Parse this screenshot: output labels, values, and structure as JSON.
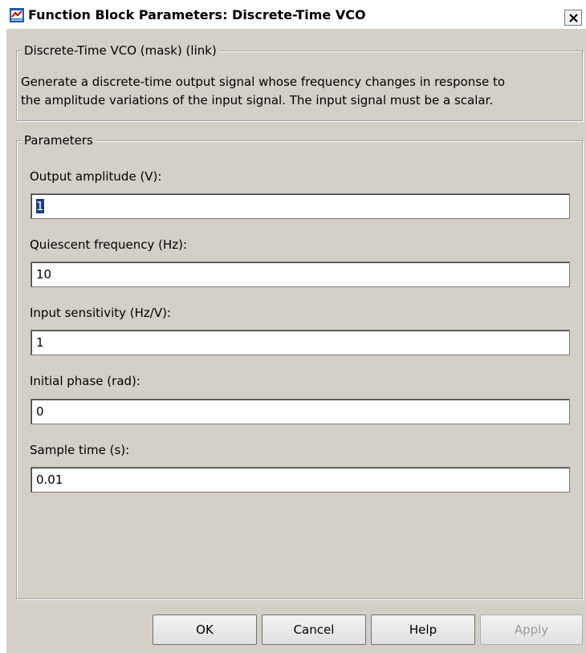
{
  "window": {
    "title": "Function Block Parameters: Discrete-Time VCO",
    "close_label": "X"
  },
  "mask": {
    "legend": "Discrete-Time VCO (mask) (link)",
    "description_line1": "Generate a discrete-time output signal whose frequency changes in response to",
    "description_line2": "the amplitude variations of the input signal. The input signal must be a scalar."
  },
  "parameters": {
    "legend": "Parameters",
    "items": [
      {
        "label": "Output amplitude (V):",
        "value": "1"
      },
      {
        "label": "Quiescent frequency (Hz):",
        "value": "10"
      },
      {
        "label": "Input sensitivity (Hz/V):",
        "value": "1"
      },
      {
        "label": "Initial phase (rad):",
        "value": "0"
      },
      {
        "label": "Sample time (s):",
        "value": "0.01"
      }
    ]
  },
  "buttons": {
    "ok": "OK",
    "cancel": "Cancel",
    "help": "Help",
    "apply": "Apply"
  },
  "icons": {
    "app": "simulink-block-icon",
    "close": "close-icon"
  }
}
